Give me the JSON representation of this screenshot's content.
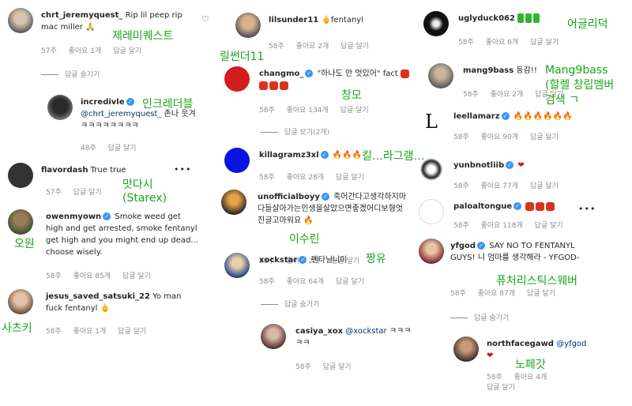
{
  "col1": {
    "c1": {
      "user": "chrt_jeremyquest_",
      "text": "Rip lil peep rip mac miller 🙏",
      "time": "57주",
      "likes": "좋아요 1개",
      "reply": "답글 달기",
      "ann": "제레미퀘스트"
    },
    "hide1": "답글 숨기기",
    "c2": {
      "user": "incredivle",
      "mention": "@chrt_jeremyquest_",
      "text": "존나 웃겨ㅋㅋㅋㅋㅋㅋㅋㅋ",
      "time": "48주",
      "reply": "답글 달기",
      "ann": "인크레더블"
    },
    "c3": {
      "user": "flavordash",
      "text": "True true",
      "time": "57주",
      "reply": "답글 달기",
      "ann": "맛다시\n(Starex)"
    },
    "c4": {
      "user": "owenmyown",
      "text": "Smoke weed get high and get arrested, smoke fentanyl get high and you might end up dead... choose wisely.",
      "time": "58주",
      "likes": "좋아요 85개",
      "reply": "답글 달기",
      "ann": "오원"
    },
    "c5": {
      "user": "jesus_saved_satsuki_22",
      "text": "Yo man fuck fentanyl 🖕",
      "time": "58주",
      "likes": "좋아요 1개",
      "reply": "답글 달기",
      "ann": "사츠키"
    }
  },
  "col2": {
    "c1": {
      "user": "lilsunder11",
      "text": "🖕fentanyl",
      "time": "58주",
      "likes": "좋아요 2개",
      "reply": "답글 달기",
      "ann": "릴썬더11"
    },
    "c2": {
      "user": "changmo_",
      "text": "\"하나도 안 멋있어\" fact",
      "time": "58주",
      "likes": "좋아요 134개",
      "reply": "답글 달기",
      "ann": "창모"
    },
    "show2": "답글 보기(2개)",
    "c3": {
      "user": "killagramz3xl",
      "text": "🔥🔥🔥",
      "time": "58주",
      "likes": "좋아요 28개",
      "reply": "답글 달기",
      "ann": "킬…라그램…"
    },
    "c4": {
      "user": "unofficialboyy",
      "text": "죽어간다고생각하지마다들살아가는인생을살았으면좋겠어디보형엇진글고마워요 🔥",
      "time": "58주",
      "likes": "좋아요 2개",
      "reply": "답글 달기",
      "ann": "이수린"
    },
    "c5": {
      "user": "xockstar",
      "text": "펜타닐니미",
      "time": "58주",
      "likes": "좋아요 64개",
      "reply": "답글 달기",
      "ann": "짱유"
    },
    "hide5": "답글 숨기기",
    "c6": {
      "user": "casiya_xox",
      "mention": "@xockstar",
      "text": "ㅋㅋㅋㅋㅋ",
      "time": "58주",
      "reply": "답글 달기"
    }
  },
  "col3": {
    "c1": {
      "user": "uglyduck062",
      "time": "58주",
      "likes": "좋아요 6개",
      "reply": "답글 달기",
      "ann": "어글리덕"
    },
    "c2": {
      "user": "mang9bass",
      "text": "동감!!",
      "time": "58주",
      "likes": "좋아요 2개",
      "reply": "답글 달기",
      "ann": "Mang9bass\n(할렐 창립멤버\n검색 ㄱ"
    },
    "c3": {
      "user": "leellamarz",
      "text": "🔥🔥🔥🔥🔥🔥",
      "time": "58주",
      "likes": "좋아요 90개",
      "reply": "답글 달기"
    },
    "c4": {
      "user": "yunbnotliib",
      "text": "❤",
      "time": "58주",
      "likes": "좋아요 77개",
      "reply": "답글 달기"
    },
    "c5": {
      "user": "paloaltongue",
      "time": "58주",
      "likes": "좋아요 118개",
      "reply": "답글 달기"
    },
    "c6": {
      "user": "yfgod",
      "text": "SAY NO TO FENTANYL GUYS! 니 엄마를 생각해라 - YFGOD-",
      "time": "58주",
      "likes": "좋아요 87개",
      "reply": "답글 달기",
      "ann": "퓨처리스틱스웨버"
    },
    "hide6": "답글 숨기기",
    "c7": {
      "user": "northfacegawd",
      "mention": "@yfgod",
      "text": "❤",
      "time": "58주",
      "likes": "좋아요 4개",
      "reply": "답글 달기",
      "ann": "노페갓"
    }
  }
}
